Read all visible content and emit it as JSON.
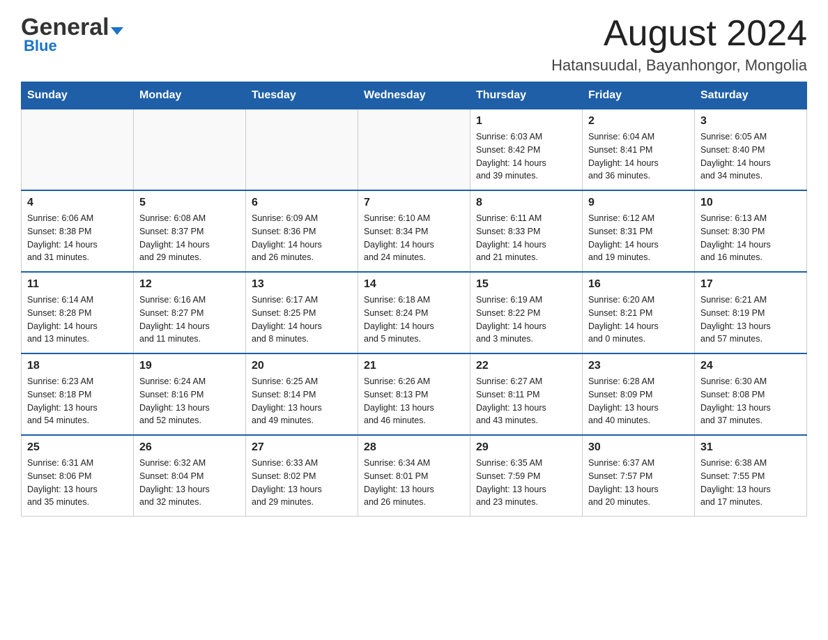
{
  "header": {
    "logo_general": "General",
    "logo_blue": "Blue",
    "month_year": "August 2024",
    "location": "Hatansuudal, Bayanhongor, Mongolia"
  },
  "days_of_week": [
    "Sunday",
    "Monday",
    "Tuesday",
    "Wednesday",
    "Thursday",
    "Friday",
    "Saturday"
  ],
  "weeks": [
    {
      "cells": [
        {
          "day": "",
          "info": ""
        },
        {
          "day": "",
          "info": ""
        },
        {
          "day": "",
          "info": ""
        },
        {
          "day": "",
          "info": ""
        },
        {
          "day": "1",
          "info": "Sunrise: 6:03 AM\nSunset: 8:42 PM\nDaylight: 14 hours\nand 39 minutes."
        },
        {
          "day": "2",
          "info": "Sunrise: 6:04 AM\nSunset: 8:41 PM\nDaylight: 14 hours\nand 36 minutes."
        },
        {
          "day": "3",
          "info": "Sunrise: 6:05 AM\nSunset: 8:40 PM\nDaylight: 14 hours\nand 34 minutes."
        }
      ]
    },
    {
      "cells": [
        {
          "day": "4",
          "info": "Sunrise: 6:06 AM\nSunset: 8:38 PM\nDaylight: 14 hours\nand 31 minutes."
        },
        {
          "day": "5",
          "info": "Sunrise: 6:08 AM\nSunset: 8:37 PM\nDaylight: 14 hours\nand 29 minutes."
        },
        {
          "day": "6",
          "info": "Sunrise: 6:09 AM\nSunset: 8:36 PM\nDaylight: 14 hours\nand 26 minutes."
        },
        {
          "day": "7",
          "info": "Sunrise: 6:10 AM\nSunset: 8:34 PM\nDaylight: 14 hours\nand 24 minutes."
        },
        {
          "day": "8",
          "info": "Sunrise: 6:11 AM\nSunset: 8:33 PM\nDaylight: 14 hours\nand 21 minutes."
        },
        {
          "day": "9",
          "info": "Sunrise: 6:12 AM\nSunset: 8:31 PM\nDaylight: 14 hours\nand 19 minutes."
        },
        {
          "day": "10",
          "info": "Sunrise: 6:13 AM\nSunset: 8:30 PM\nDaylight: 14 hours\nand 16 minutes."
        }
      ]
    },
    {
      "cells": [
        {
          "day": "11",
          "info": "Sunrise: 6:14 AM\nSunset: 8:28 PM\nDaylight: 14 hours\nand 13 minutes."
        },
        {
          "day": "12",
          "info": "Sunrise: 6:16 AM\nSunset: 8:27 PM\nDaylight: 14 hours\nand 11 minutes."
        },
        {
          "day": "13",
          "info": "Sunrise: 6:17 AM\nSunset: 8:25 PM\nDaylight: 14 hours\nand 8 minutes."
        },
        {
          "day": "14",
          "info": "Sunrise: 6:18 AM\nSunset: 8:24 PM\nDaylight: 14 hours\nand 5 minutes."
        },
        {
          "day": "15",
          "info": "Sunrise: 6:19 AM\nSunset: 8:22 PM\nDaylight: 14 hours\nand 3 minutes."
        },
        {
          "day": "16",
          "info": "Sunrise: 6:20 AM\nSunset: 8:21 PM\nDaylight: 14 hours\nand 0 minutes."
        },
        {
          "day": "17",
          "info": "Sunrise: 6:21 AM\nSunset: 8:19 PM\nDaylight: 13 hours\nand 57 minutes."
        }
      ]
    },
    {
      "cells": [
        {
          "day": "18",
          "info": "Sunrise: 6:23 AM\nSunset: 8:18 PM\nDaylight: 13 hours\nand 54 minutes."
        },
        {
          "day": "19",
          "info": "Sunrise: 6:24 AM\nSunset: 8:16 PM\nDaylight: 13 hours\nand 52 minutes."
        },
        {
          "day": "20",
          "info": "Sunrise: 6:25 AM\nSunset: 8:14 PM\nDaylight: 13 hours\nand 49 minutes."
        },
        {
          "day": "21",
          "info": "Sunrise: 6:26 AM\nSunset: 8:13 PM\nDaylight: 13 hours\nand 46 minutes."
        },
        {
          "day": "22",
          "info": "Sunrise: 6:27 AM\nSunset: 8:11 PM\nDaylight: 13 hours\nand 43 minutes."
        },
        {
          "day": "23",
          "info": "Sunrise: 6:28 AM\nSunset: 8:09 PM\nDaylight: 13 hours\nand 40 minutes."
        },
        {
          "day": "24",
          "info": "Sunrise: 6:30 AM\nSunset: 8:08 PM\nDaylight: 13 hours\nand 37 minutes."
        }
      ]
    },
    {
      "cells": [
        {
          "day": "25",
          "info": "Sunrise: 6:31 AM\nSunset: 8:06 PM\nDaylight: 13 hours\nand 35 minutes."
        },
        {
          "day": "26",
          "info": "Sunrise: 6:32 AM\nSunset: 8:04 PM\nDaylight: 13 hours\nand 32 minutes."
        },
        {
          "day": "27",
          "info": "Sunrise: 6:33 AM\nSunset: 8:02 PM\nDaylight: 13 hours\nand 29 minutes."
        },
        {
          "day": "28",
          "info": "Sunrise: 6:34 AM\nSunset: 8:01 PM\nDaylight: 13 hours\nand 26 minutes."
        },
        {
          "day": "29",
          "info": "Sunrise: 6:35 AM\nSunset: 7:59 PM\nDaylight: 13 hours\nand 23 minutes."
        },
        {
          "day": "30",
          "info": "Sunrise: 6:37 AM\nSunset: 7:57 PM\nDaylight: 13 hours\nand 20 minutes."
        },
        {
          "day": "31",
          "info": "Sunrise: 6:38 AM\nSunset: 7:55 PM\nDaylight: 13 hours\nand 17 minutes."
        }
      ]
    }
  ]
}
